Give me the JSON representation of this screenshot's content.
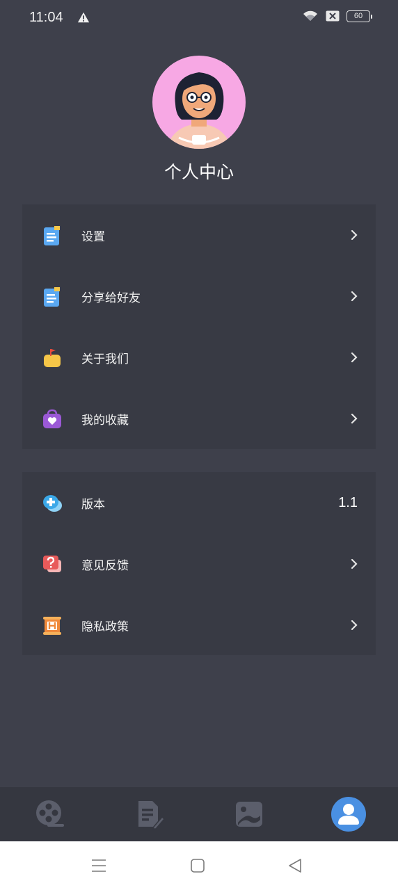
{
  "status": {
    "time": "11:04",
    "battery": "60"
  },
  "profile": {
    "title": "个人中心"
  },
  "menu1": [
    {
      "label": "设置",
      "icon": "notepad-icon"
    },
    {
      "label": "分享给好友",
      "icon": "notepad-icon"
    },
    {
      "label": "关于我们",
      "icon": "thumbs-up-icon"
    },
    {
      "label": "我的收藏",
      "icon": "heart-bag-icon"
    }
  ],
  "menu2": [
    {
      "label": "版本",
      "value": "1.1",
      "icon": "plus-chat-icon"
    },
    {
      "label": "意见反馈",
      "icon": "question-chat-icon"
    },
    {
      "label": "隐私政策",
      "icon": "scroll-icon"
    }
  ],
  "tabs": [
    {
      "name": "film-reel-icon",
      "active": false
    },
    {
      "name": "edit-document-icon",
      "active": false
    },
    {
      "name": "photo-icon",
      "active": false
    },
    {
      "name": "user-icon",
      "active": true
    }
  ],
  "colors": {
    "background": "#3e404b",
    "card": "#383a44",
    "tabbar": "#353740",
    "accent": "#4a90e2"
  }
}
